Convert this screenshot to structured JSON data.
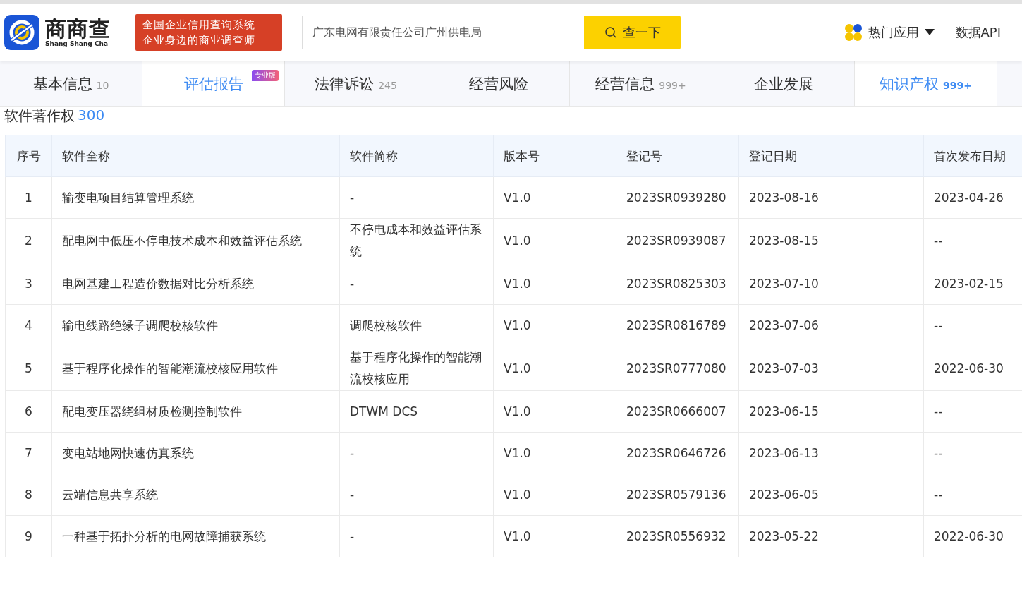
{
  "header": {
    "logo_text": "商商查",
    "logo_subtext": "Shang Shang Cha",
    "slogan_lines": [
      "全国企业信用查询系统",
      "企业身边的商业调查师"
    ],
    "search": {
      "value": "广东电网有限责任公司广州供电局",
      "button": "查一下"
    },
    "nav": [
      {
        "kind": "menu",
        "label": "热门应用"
      },
      {
        "kind": "link",
        "label": "数据API"
      }
    ]
  },
  "tabs": [
    {
      "label": "基本信息",
      "count": "10",
      "selected": false
    },
    {
      "label": "评估报告",
      "badge": "专业版",
      "selected": true
    },
    {
      "label": "法律诉讼",
      "count": "245",
      "selected": false
    },
    {
      "label": "经营风险",
      "selected": false
    },
    {
      "label": "经营信息",
      "count": "999+",
      "selected": false
    },
    {
      "label": "企业发展",
      "selected": false
    },
    {
      "label": "知识产权",
      "count": "999+",
      "selected": true
    }
  ],
  "section": {
    "title": "软件著作权",
    "count": "300"
  },
  "table": {
    "columns": [
      "序号",
      "软件全称",
      "软件简称",
      "版本号",
      "登记号",
      "登记日期",
      "首次发布日期"
    ],
    "rows": [
      [
        "1",
        "输变电项目结算管理系统",
        "-",
        "V1.0",
        "2023SR0939280",
        "2023-08-16",
        "2023-04-26"
      ],
      [
        "2",
        "配电网中低压不停电技术成本和效益评估系统",
        "不停电成本和效益评估系统",
        "V1.0",
        "2023SR0939087",
        "2023-08-15",
        "--"
      ],
      [
        "3",
        "电网基建工程造价数据对比分析系统",
        "-",
        "V1.0",
        "2023SR0825303",
        "2023-07-10",
        "2023-02-15"
      ],
      [
        "4",
        "输电线路绝缘子调爬校核软件",
        "调爬校核软件",
        "V1.0",
        "2023SR0816789",
        "2023-07-06",
        "--"
      ],
      [
        "5",
        "基于程序化操作的智能潮流校核应用软件",
        "基于程序化操作的智能潮流校核应用",
        "V1.0",
        "2023SR0777080",
        "2023-07-03",
        "2022-06-30"
      ],
      [
        "6",
        "配电变压器绕组材质检测控制软件",
        "DTWM DCS",
        "V1.0",
        "2023SR0666007",
        "2023-06-15",
        "--"
      ],
      [
        "7",
        "变电站地网快速仿真系统",
        "-",
        "V1.0",
        "2023SR0646726",
        "2023-06-13",
        "--"
      ],
      [
        "8",
        "云端信息共享系统",
        "-",
        "V1.0",
        "2023SR0579136",
        "2023-06-05",
        "--"
      ],
      [
        "9",
        "一种基于拓扑分析的电网故障捕获系统",
        "-",
        "V1.0",
        "2023SR0556932",
        "2023-05-22",
        "2022-06-30"
      ]
    ]
  }
}
